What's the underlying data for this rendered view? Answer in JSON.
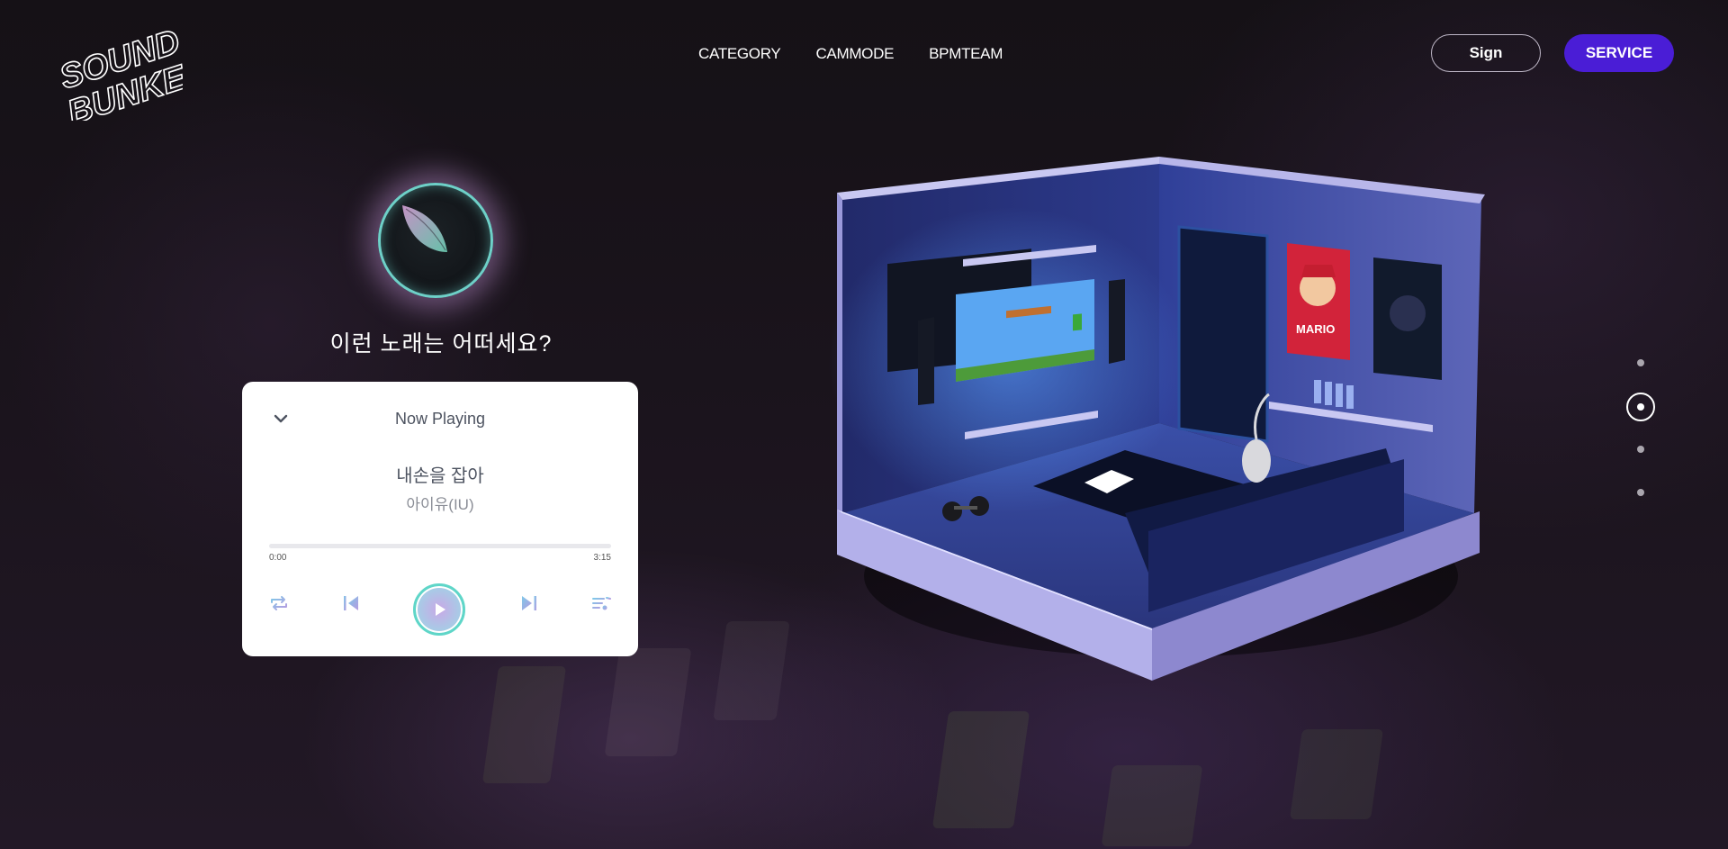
{
  "brand": {
    "logo_line1": "SOUND",
    "logo_line2": "BUNKER"
  },
  "nav": {
    "items": [
      "CATEGORY",
      "CAMMODE",
      "BPMTEAM"
    ]
  },
  "header": {
    "sign_label": "Sign",
    "service_label": "SERVICE",
    "accent": "#4a1dd6"
  },
  "hero": {
    "question": "이런 노래는 어떠세요?"
  },
  "player": {
    "heading": "Now Playing",
    "song_title": "내손을 잡아",
    "artist": "아이유(IU)",
    "time_current": "0:00",
    "time_total": "3:15",
    "progress": 0,
    "icons": [
      "chevron-down-icon",
      "repeat-icon",
      "previous-icon",
      "play-icon",
      "next-icon",
      "playlist-icon"
    ]
  },
  "room_art": {
    "poster_text": "MARIO"
  },
  "pagination": {
    "count": 4,
    "active_index": 1
  }
}
